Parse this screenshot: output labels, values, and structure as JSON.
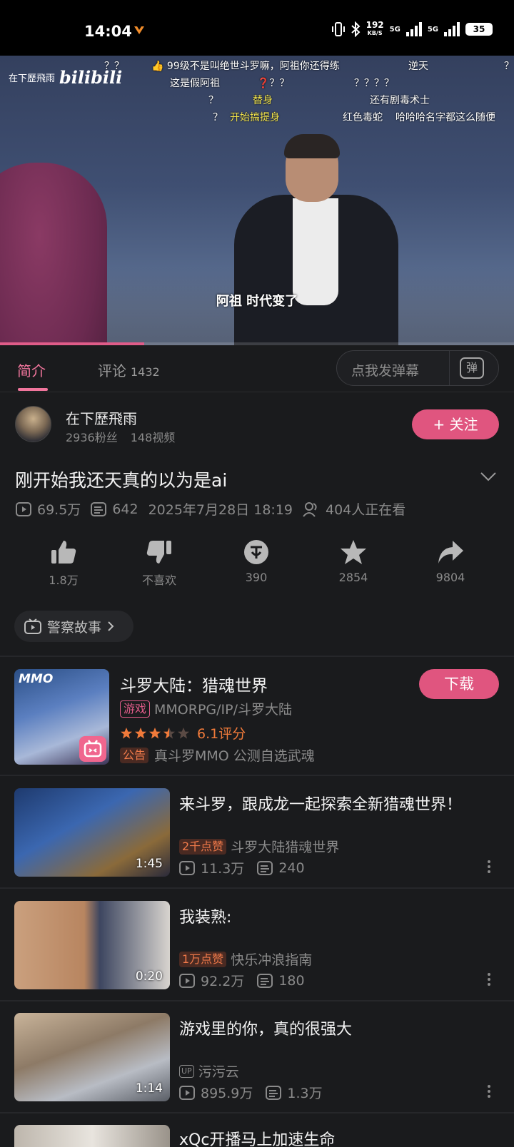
{
  "status_bar": {
    "time": "14:04",
    "speed": "192",
    "speed_unit": "KB/S",
    "signal1": "5G",
    "signal2": "5G",
    "battery": "35"
  },
  "video": {
    "logo_text": "在下歷飛雨",
    "logo_brand": "bilibili",
    "subtitle": "阿祖 时代变了",
    "progress": 0.28,
    "danmaku": [
      {
        "text": "？？",
        "color": "white"
      },
      {
        "text": "👍 99级不是叫绝世斗罗嘛，阿祖你还得练",
        "color": "white"
      },
      {
        "text": "逆天",
        "color": "white"
      },
      {
        "text": "？",
        "color": "white"
      },
      {
        "text": "这是假阿祖",
        "color": "white"
      },
      {
        "text": "❓？？",
        "color": "white"
      },
      {
        "text": "？？？？",
        "color": "white"
      },
      {
        "text": "？",
        "color": "white"
      },
      {
        "text": "替身",
        "color": "yellow"
      },
      {
        "text": "还有剧毒术士",
        "color": "white"
      },
      {
        "text": "？",
        "color": "white"
      },
      {
        "text": "开始搞提身",
        "color": "yellow"
      },
      {
        "text": "红色毒蛇",
        "color": "white"
      },
      {
        "text": "哈哈哈名字都这么随便",
        "color": "white"
      }
    ]
  },
  "tabs": {
    "intro": "简介",
    "comments": "评论",
    "comments_count": "1432",
    "danmaku_placeholder": "点我发弹幕",
    "danmaku_btn": "弹"
  },
  "uploader": {
    "name": "在下歷飛雨",
    "fans": "2936粉丝",
    "videos": "148视频",
    "follow": "+ 关注"
  },
  "video_info": {
    "title": "刚开始我还天真的以为是ai",
    "views": "69.5万",
    "danmaku_count": "642",
    "date": "2025年7月28日 18:19",
    "watching": "404人正在看"
  },
  "actions": {
    "like": "1.8万",
    "dislike": "不喜欢",
    "coin": "390",
    "favorite": "2854",
    "share": "9804"
  },
  "tag": "警察故事",
  "game_ad": {
    "thumb_label": "MMO",
    "title": "斗罗大陆：猎魂世界",
    "category_pill": "游戏",
    "category": "MMORPG/IP/斗罗大陆",
    "rating": 3.5,
    "rating_text": "6.1评分",
    "notice_pill": "公告",
    "notice": "真斗罗MMO 公测自选武魂",
    "download": "下载"
  },
  "related": [
    {
      "title": "来斗罗，跟成龙一起探索全新猎魂世界！",
      "duration": "1:45",
      "badge": "2千点赞",
      "source": "斗罗大陆猎魂世界",
      "views": "11.3万",
      "danmaku": "240"
    },
    {
      "title": "我装熟:",
      "duration": "0:20",
      "badge": "1万点赞",
      "source": "快乐冲浪指南",
      "views": "92.2万",
      "danmaku": "180"
    },
    {
      "title": "游戏里的你，真的很强大",
      "duration": "1:14",
      "badge": "UP",
      "source": "污污云",
      "views": "895.9万",
      "danmaku": "1.3万"
    },
    {
      "title": "xQc开播马上加速生命",
      "duration": "",
      "badge": "",
      "source": "",
      "views": "",
      "danmaku": ""
    }
  ],
  "colors": {
    "accent": "#e0557f",
    "background": "#1a1b1d",
    "muted": "#8a8a8a",
    "rating": "#f07a3a"
  }
}
